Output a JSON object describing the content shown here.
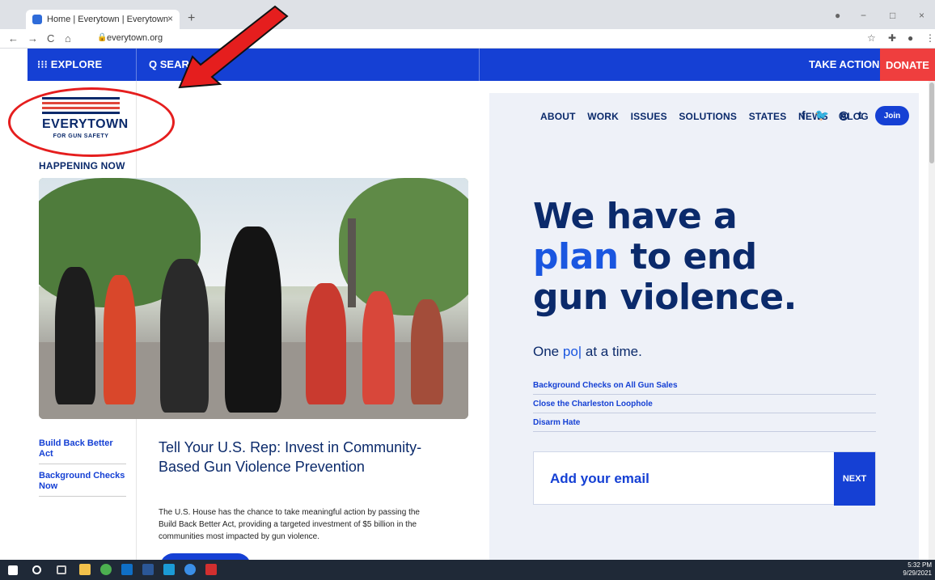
{
  "browser": {
    "tab_title": "Home | Everytown | Everytown",
    "tab_close": "×",
    "new_tab": "+",
    "url": "everytown.org",
    "back": "←",
    "forward": "→",
    "reload": "C",
    "home": "⌂",
    "lock": "🔒",
    "star": "☆",
    "extensions": "✚",
    "profile": "●",
    "menu": "⋮",
    "win_min": "−",
    "win_max": "□",
    "win_close": "×",
    "profile_dot": "●"
  },
  "sitenav": {
    "explore": "⁝⁝⁝ EXPLORE",
    "search": "Q SEAR",
    "take_action": "TAKE ACTION",
    "donate": "DONATE"
  },
  "logo": {
    "word": "EVERYTOWN",
    "sub": "FOR GUN SAFETY",
    "bar_colors": [
      "#0b2a6b",
      "#e0463a",
      "#e0463a",
      "#0b2a6b"
    ]
  },
  "happening": "HAPPENING NOW",
  "sidelinks": [
    "Build Back Better Act",
    "Background Checks Now"
  ],
  "story": {
    "title": "Tell Your U.S. Rep: Invest in Community-Based Gun Violence Prevention",
    "body": "The U.S. House has the chance to take meaningful action by passing the Build Back Better Act, providing a targeted investment of $5 billion in the communities most impacted by gun violence."
  },
  "menu": [
    "ABOUT",
    "WORK",
    "ISSUES",
    "SOLUTIONS",
    "STATES",
    "NEWS",
    "BLOG"
  ],
  "social": [
    "f",
    "🐦",
    "◎",
    "t"
  ],
  "join": "Join",
  "headline": {
    "line1": "We have a",
    "line2_hl": "plan",
    "line2_rest": " to end",
    "line3": "gun violence."
  },
  "tagline": {
    "pre": "One ",
    "hl": "po|",
    "post": " at a time."
  },
  "policy_links": [
    "Background Checks on All Gun Sales",
    "Close the Charleston Loophole",
    "Disarm Hate"
  ],
  "email": {
    "placeholder": "Add your email",
    "next": "NEXT"
  },
  "taskbar": {
    "time": "5:32 PM",
    "date": "9/29/2021"
  },
  "colors": {
    "nav_blue": "#1540d4",
    "navy": "#0b2a6b",
    "donate_red": "#ef3e3e",
    "annotation_red": "#e51e1e"
  }
}
